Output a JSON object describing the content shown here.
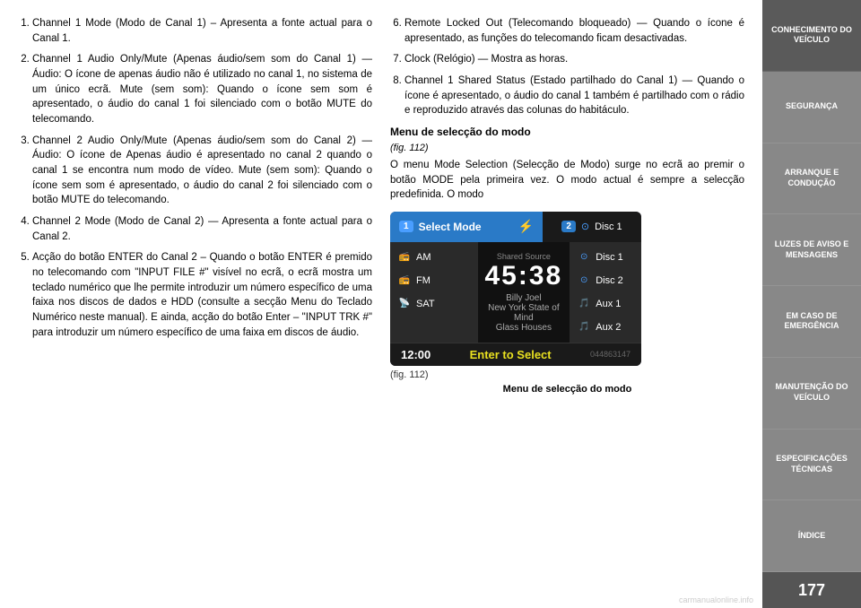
{
  "main": {
    "col_left": {
      "items": [
        {
          "num": "1.",
          "text": "Channel 1 Mode (Modo de Canal 1) – Apresenta a fonte actual para o Canal 1."
        },
        {
          "num": "2.",
          "text": "Channel 1 Audio Only/Mute (Apenas áudio/sem som do Canal 1) — Áudio: O ícone de apenas áudio não é utilizado no canal 1, no sistema de um único ecrã. Mute (sem som): Quando o ícone sem som é apresentado, o áudio do canal 1 foi silenciado com o botão MUTE do telecomando."
        },
        {
          "num": "3.",
          "text": "Channel 2 Audio Only/Mute (Apenas áudio/sem som do Canal 2) — Áudio: O ícone de Apenas áudio é apresentado no canal 2 quando o canal 1 se encontra num modo de vídeo. Mute (sem som): Quando o ícone sem som é apresentado, o áudio do canal 2 foi silenciado com o botão MUTE do telecomando."
        },
        {
          "num": "4.",
          "text": "Channel 2 Mode (Modo de Canal 2) — Apresenta a fonte actual para o Canal 2."
        },
        {
          "num": "5.",
          "text": "Acção do botão ENTER do Canal 2 – Quando o botão ENTER é premido no telecomando com \"INPUT FILE #\" visível no ecrã, o ecrã mostra um teclado numérico que lhe permite introduzir um número específico de uma faixa nos discos de dados e HDD (consulte a secção Menu do Teclado Numérico neste manual). E ainda, acção do botão Enter – \"INPUT TRK #\" para introduzir um número específico de uma faixa em discos de áudio."
        }
      ]
    },
    "col_right": {
      "items": [
        {
          "num": "6.",
          "text": "Remote Locked Out (Telecomando bloqueado) — Quando o ícone é apresentado, as funções do telecomando ficam desactivadas."
        },
        {
          "num": "7.",
          "text": "Clock (Relógio) — Mostra as horas."
        },
        {
          "num": "8.",
          "text": "Channel 1 Shared Status (Estado partilhado do Canal 1) — Quando o ícone é apresentado, o áudio do canal 1 também é partilhado com o rádio e reproduzido através das colunas do habitáculo."
        }
      ],
      "section_title": "Menu de selecção do modo",
      "fig_ref": "(fig. 112)",
      "section_body": "O menu Mode Selection (Selecção de Modo) surge no ecrã ao premir o botão MODE pela primeira vez. O modo actual é sempre a selecção predefinida. O modo"
    }
  },
  "ui": {
    "top_left_badge": "1",
    "top_left_label": "Select Mode",
    "bluetooth_icon": "🔵",
    "top_right_badge": "2",
    "top_right_disc_icon": "⊙",
    "top_right_label": "Disc 1",
    "list_items": [
      {
        "icon": "📻",
        "label": "AM"
      },
      {
        "icon": "📻",
        "label": "FM"
      },
      {
        "icon": "📡",
        "label": "SAT"
      }
    ],
    "right_list_items": [
      {
        "icon": "⊙",
        "label": "Disc 1"
      },
      {
        "icon": "⊙",
        "label": "Disc 2"
      },
      {
        "icon": "🎵",
        "label": "Aux 1"
      },
      {
        "icon": "🎵",
        "label": "Aux 2"
      }
    ],
    "shared_source": "Shared Source",
    "time": "45:38",
    "artist": "Billy Joel",
    "song": "New York State of Mind",
    "album": "Glass Houses",
    "time_left": "12:00",
    "enter_to_select": "Enter to Select",
    "product_code": "044863147"
  },
  "fig_caption": "(fig. 112)",
  "fig_title": "Menu de selecção do modo",
  "sidebar": {
    "items": [
      {
        "label": "CONHECIMENTO\nDO VEÍCULO",
        "active": true
      },
      {
        "label": "SEGURANÇA"
      },
      {
        "label": "ARRANQUE\nE CONDUÇÃO"
      },
      {
        "label": "LUZES DE\nAVISO E\nMENSAGENS"
      },
      {
        "label": "EM CASO DE\nEMERGÊNCIA"
      },
      {
        "label": "MANUTENÇÃO\nDO VEÍCULO"
      },
      {
        "label": "ESPECIFICAÇÕES\nTÉCNICAS"
      },
      {
        "label": "ÍNDICE"
      }
    ],
    "page_number": "177"
  },
  "watermark": "carmanualonline.info"
}
